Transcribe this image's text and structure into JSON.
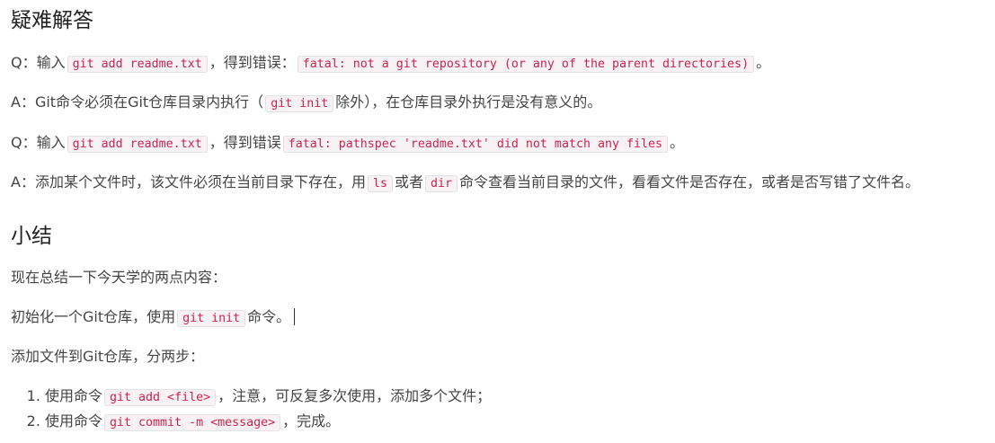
{
  "faq": {
    "heading": "疑难解答",
    "items": [
      {
        "pre": "Q：输入",
        "code1": "git add readme.txt",
        "mid": "，得到错误：",
        "code2": "fatal: not a git repository (or any of the parent directories)",
        "post": "。"
      },
      {
        "pre": "A：Git命令必须在Git仓库目录内执行（",
        "code1": "git init",
        "post": "除外），在仓库目录外执行是没有意义的。"
      },
      {
        "pre": "Q：输入",
        "code1": "git add readme.txt",
        "mid": "，得到错误",
        "code2": "fatal: pathspec 'readme.txt' did not match any files",
        "post": "。"
      },
      {
        "pre": "A：添加某个文件时，该文件必须在当前目录下存在，用",
        "code1": "ls",
        "mid": "或者",
        "code2": "dir",
        "post": "命令查看当前目录的文件，看看文件是否存在，或者是否写错了文件名。"
      }
    ]
  },
  "summary": {
    "heading": "小结",
    "intro": "现在总结一下今天学的两点内容：",
    "p1_pre": "初始化一个Git仓库，使用",
    "p1_code": "git init",
    "p1_post": "命令。",
    "p2": "添加文件到Git仓库，分两步：",
    "steps": [
      {
        "pre": "使用命令",
        "code": "git add <file>",
        "post": "，注意，可反复多次使用，添加多个文件；"
      },
      {
        "pre": "使用命令",
        "code": "git commit -m <message>",
        "post": "，完成。"
      }
    ]
  }
}
